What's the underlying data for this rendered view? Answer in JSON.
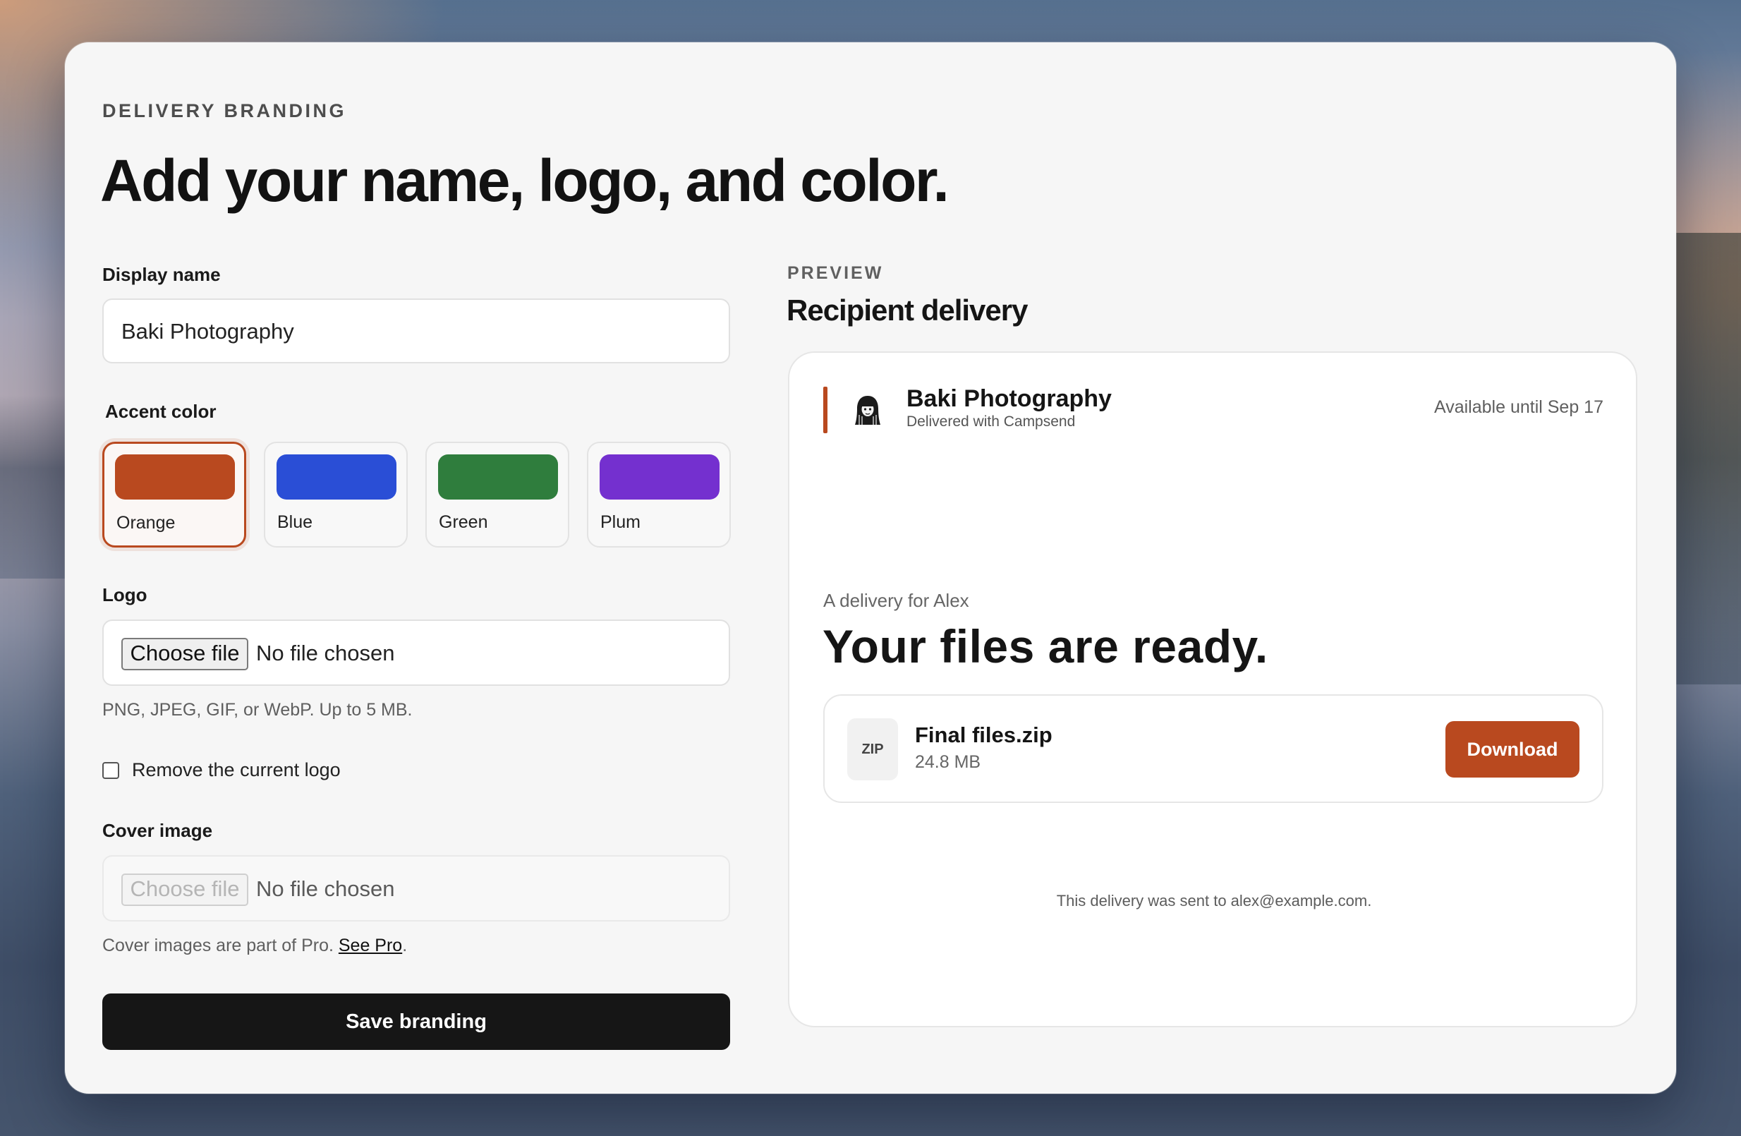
{
  "page": {
    "eyebrow": "DELIVERY BRANDING",
    "title": "Add your name, logo, and color."
  },
  "form": {
    "display_name_label": "Display name",
    "display_name_value": "Baki Photography",
    "accent_label": "Accent color",
    "swatches": [
      {
        "label": "Orange",
        "color": "#b9491f",
        "selected": true
      },
      {
        "label": "Blue",
        "color": "#2a4ed6",
        "selected": false
      },
      {
        "label": "Green",
        "color": "#2f7d3d",
        "selected": false
      },
      {
        "label": "Plum",
        "color": "#7430cf",
        "selected": false
      }
    ],
    "logo_label": "Logo",
    "logo_button": "Choose file",
    "logo_status": "No file chosen",
    "logo_hint": "PNG, JPEG, GIF, or WebP. Up to 5 MB.",
    "remove_logo_label": "Remove the current logo",
    "remove_logo_checked": false,
    "cover_label": "Cover image",
    "cover_button": "Choose file",
    "cover_status": "No file chosen",
    "cover_hint": "Cover images are part of Pro.",
    "cover_hint_link": "See Pro",
    "cover_hint_end": ".",
    "save_button": "Save branding"
  },
  "preview": {
    "eyebrow": "PREVIEW",
    "title": "Recipient delivery",
    "brand_name": "Baki Photography",
    "brand_sub": "Delivered with Campsend",
    "available": "Available until Sep 17",
    "for_label": "A delivery for Alex",
    "headline": "Your files are ready.",
    "file": {
      "badge": "ZIP",
      "name": "Final files.zip",
      "size": "24.8 MB",
      "download": "Download"
    },
    "sent_note": "This delivery was sent to alex@example.com.",
    "accent_color": "#b9491f"
  },
  "icons": {
    "avatar": "photographer-avatar-icon"
  }
}
